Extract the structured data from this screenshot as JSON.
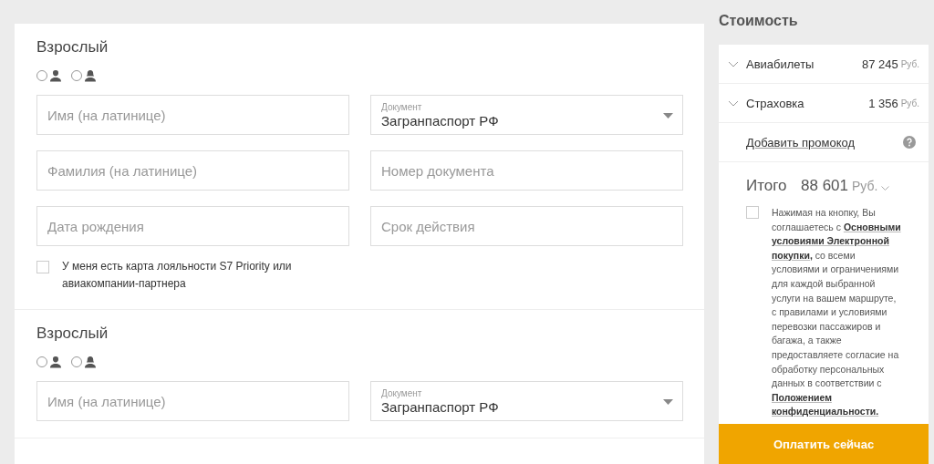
{
  "passengers": [
    {
      "title": "Взрослый",
      "gender_options": [
        {
          "kind": "male",
          "selected": false
        },
        {
          "kind": "female",
          "selected": false
        }
      ],
      "field_columns": [
        [
          {
            "kind": "input",
            "placeholder": "Имя (на латинице)"
          },
          {
            "kind": "input",
            "placeholder": "Фамилия (на латинице)"
          },
          {
            "kind": "input",
            "placeholder": "Дата рождения"
          }
        ],
        [
          {
            "kind": "select",
            "label": "Документ",
            "value": "Загранпаспорт РФ"
          },
          {
            "kind": "input",
            "placeholder": "Номер документа"
          },
          {
            "kind": "input",
            "placeholder": "Срок действия"
          }
        ]
      ],
      "loyalty": {
        "label": "У меня есть карта лояльности S7 Priority или авиакомпании-партнера",
        "checked": false
      }
    },
    {
      "title": "Взрослый",
      "gender_options": [
        {
          "kind": "male",
          "selected": false
        },
        {
          "kind": "female",
          "selected": false
        }
      ],
      "field_columns": [
        [
          {
            "kind": "input",
            "placeholder": "Имя (на латинице)"
          }
        ],
        [
          {
            "kind": "select",
            "label": "Документ",
            "value": "Загранпаспорт РФ"
          }
        ]
      ]
    }
  ],
  "cost": {
    "title": "Стоимость",
    "items": [
      {
        "label": "Авиабилеты",
        "amount": "87 245",
        "currency": "Руб.",
        "expanded": false
      },
      {
        "label": "Страховка",
        "amount": "1 356",
        "currency": "Руб.",
        "expanded": false
      }
    ],
    "promo_link": "Добавить промокод",
    "total": {
      "label": "Итого",
      "amount": "88 601",
      "currency": "Руб."
    },
    "consent": {
      "checked": false,
      "text": "Нажимая на кнопку, Вы соглашаетесь с **Основными условиями Электронной покупки,** со всеми условиями и ограничениями для каждой выбранной услуги на вашем маршруте, с правилами и условиями перевозки пассажиров и багажа, а также предоставляете согласие на обработку персональных данных в соответствии с **Положением конфиденциальности.**"
    },
    "pay_button": "Оплатить сейчас"
  }
}
